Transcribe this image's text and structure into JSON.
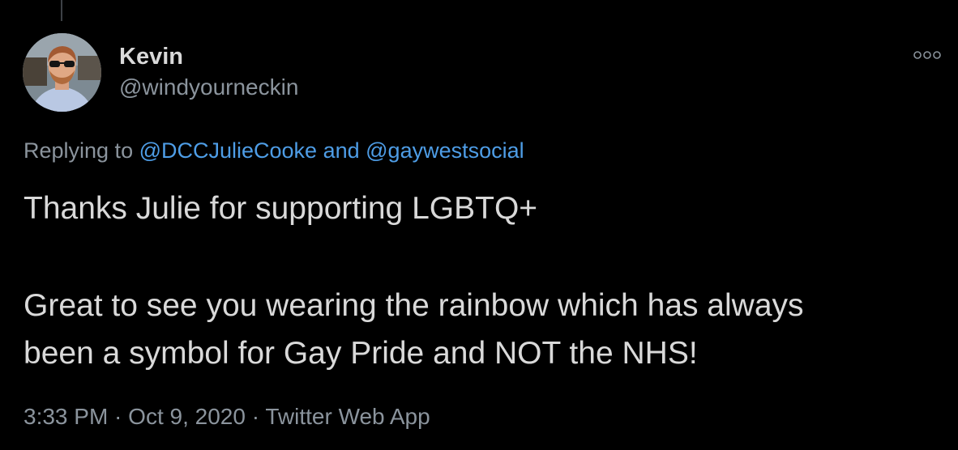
{
  "tweet": {
    "author": {
      "name": "Kevin",
      "handle": "@windyourneckin"
    },
    "more_icon": "more-options-icon",
    "replying": {
      "prefix": "Replying to ",
      "mention1": "@DCCJulieCooke",
      "conjunction": " and ",
      "mention2": "@gaywestsocial"
    },
    "text": {
      "line1": "Thanks Julie for supporting LGBTQ+",
      "line2": "Great to see you wearing the rainbow which has always",
      "line3": "been a symbol for Gay Pride and NOT the NHS!"
    },
    "meta": {
      "time": "3:33 PM",
      "sep1": " · ",
      "date": "Oct 9, 2020",
      "sep2": " · ",
      "source": "Twitter Web App"
    }
  },
  "colors": {
    "background": "#000000",
    "text": "#d9d9d9",
    "secondary_text": "#8b949d",
    "link": "#4e9de6"
  }
}
